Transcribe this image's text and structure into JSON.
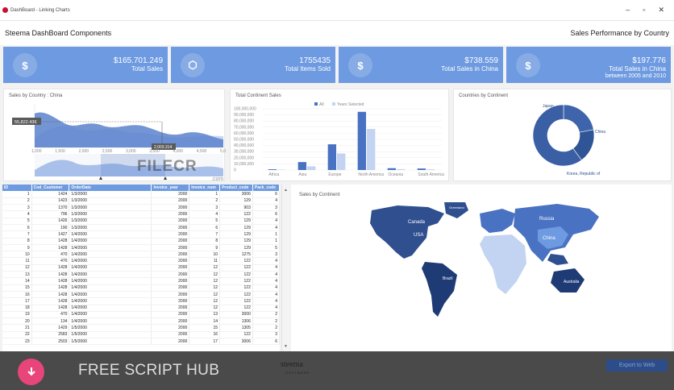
{
  "window": {
    "title": "DashBoard - Linking Charts",
    "minimize": "–",
    "maximize": "▫",
    "close": "✕"
  },
  "header": {
    "left_title": "Steema DashBoard Components",
    "right_title": "Sales Performance by Country"
  },
  "kpis": [
    {
      "icon": "dollar-icon",
      "glyph": "$",
      "value": "$165.701.249",
      "label": "Total Sales",
      "sub": ""
    },
    {
      "icon": "box-icon",
      "glyph": "⬡",
      "value": "1755435",
      "label": "Total Items Sold",
      "sub": ""
    },
    {
      "icon": "dollar-icon",
      "glyph": "$",
      "value": "$738.559",
      "label": "Total Sales in China",
      "sub": ""
    },
    {
      "icon": "dollar-icon",
      "glyph": "$",
      "value": "$197.776",
      "label": "Total Sales in China",
      "sub": "between 2005 and 2010"
    }
  ],
  "panels": {
    "sales_by_country": "Sales by Country : China",
    "total_continent": "Total Continent Sales",
    "countries_by_continent": "Countries by Continent",
    "sales_by_continent": "Sales by Continent"
  },
  "area_chart": {
    "value_label": "55,822.436",
    "cursor_label": "2,003.314",
    "x_ticks": [
      "1,000",
      "1,500",
      "2,000",
      "2,500",
      "3,000",
      "3,500",
      "4,000",
      "4,500",
      "5,000"
    ]
  },
  "chart_data": [
    {
      "type": "bar",
      "title": "Total Continent Sales",
      "categories": [
        "Africa",
        "Asia",
        "Europe",
        "North America",
        "Oceania",
        "South America"
      ],
      "series": [
        {
          "name": "All",
          "color": "#4a72c2",
          "values": [
            1200000,
            13000000,
            42000000,
            95000000,
            3000000,
            2500000
          ]
        },
        {
          "name": "Years Selected",
          "color": "#c2d4f2",
          "values": [
            600000,
            6000000,
            27000000,
            67000000,
            1500000,
            1200000
          ]
        }
      ],
      "y_ticks": [
        "0",
        "10,000,000",
        "20,000,000",
        "30,000,000",
        "40,000,000",
        "50,000,000",
        "60,000,000",
        "70,000,000",
        "80,000,000",
        "90,000,000",
        "100,000,000"
      ],
      "ylim": [
        0,
        100000000
      ],
      "legend": "top"
    },
    {
      "type": "pie",
      "title": "Countries by Continent",
      "labels": [
        "Japan",
        "China",
        "Korea, Republic of"
      ],
      "values": [
        22,
        18,
        60
      ],
      "colors": [
        "#3e64ab",
        "#2f5597",
        "#3a5fa5"
      ]
    }
  ],
  "map": {
    "labels": [
      "Canada",
      "USA",
      "Greenland",
      "Russia",
      "China",
      "Brazil",
      "Australia"
    ]
  },
  "grid": {
    "columns": [
      "ID",
      "Cod_Customer",
      "OrderDate",
      "Invoice_year",
      "Invoice_num",
      "Product_code",
      "Pack_code"
    ],
    "rows": [
      [
        "1",
        "1424",
        "1/3/2000",
        "2000",
        "1",
        "3006",
        "6"
      ],
      [
        "2",
        "1423",
        "1/3/2000",
        "2000",
        "2",
        "129",
        "4"
      ],
      [
        "3",
        "1370",
        "1/3/2000",
        "2000",
        "3",
        "903",
        "3"
      ],
      [
        "4",
        "796",
        "1/3/2000",
        "2000",
        "4",
        "122",
        "6"
      ],
      [
        "5",
        "1426",
        "1/3/2000",
        "2000",
        "5",
        "129",
        "4"
      ],
      [
        "6",
        "190",
        "1/3/2000",
        "2000",
        "6",
        "129",
        "4"
      ],
      [
        "7",
        "1427",
        "1/4/2000",
        "2000",
        "7",
        "129",
        "1"
      ],
      [
        "8",
        "1428",
        "1/4/2000",
        "2000",
        "8",
        "129",
        "1"
      ],
      [
        "9",
        "1428",
        "1/4/2000",
        "2000",
        "9",
        "129",
        "5"
      ],
      [
        "10",
        "470",
        "1/4/2000",
        "2000",
        "10",
        "1275",
        "3"
      ],
      [
        "11",
        "470",
        "1/4/2000",
        "2000",
        "11",
        "122",
        "4"
      ],
      [
        "12",
        "1428",
        "1/4/2000",
        "2000",
        "12",
        "122",
        "4"
      ],
      [
        "13",
        "1428",
        "1/4/2000",
        "2000",
        "12",
        "122",
        "4"
      ],
      [
        "14",
        "1428",
        "1/4/2000",
        "2000",
        "12",
        "122",
        "4"
      ],
      [
        "15",
        "1428",
        "1/4/2000",
        "2000",
        "12",
        "122",
        "4"
      ],
      [
        "16",
        "1428",
        "1/4/2000",
        "2000",
        "12",
        "122",
        "4"
      ],
      [
        "17",
        "1428",
        "1/4/2000",
        "2000",
        "12",
        "122",
        "4"
      ],
      [
        "18",
        "1428",
        "1/4/2000",
        "2000",
        "12",
        "122",
        "4"
      ],
      [
        "19",
        "470",
        "1/4/2000",
        "2000",
        "13",
        "3000",
        "2"
      ],
      [
        "20",
        "134",
        "1/4/2000",
        "2000",
        "14",
        "1306",
        "2"
      ],
      [
        "21",
        "1429",
        "1/5/2000",
        "2000",
        "15",
        "1305",
        "2"
      ],
      [
        "22",
        "2583",
        "1/5/2000",
        "2000",
        "16",
        "122",
        "3"
      ],
      [
        "23",
        "2503",
        "1/5/2000",
        "2000",
        "17",
        "3006",
        "6"
      ]
    ]
  },
  "footer": {
    "brand": "FREE SCRIPT HUB",
    "logo": "steema",
    "logo_sub": "SOFTWARE",
    "export": "Export to Web"
  },
  "watermark": {
    "text": "FILECR",
    "sub": ".com"
  }
}
